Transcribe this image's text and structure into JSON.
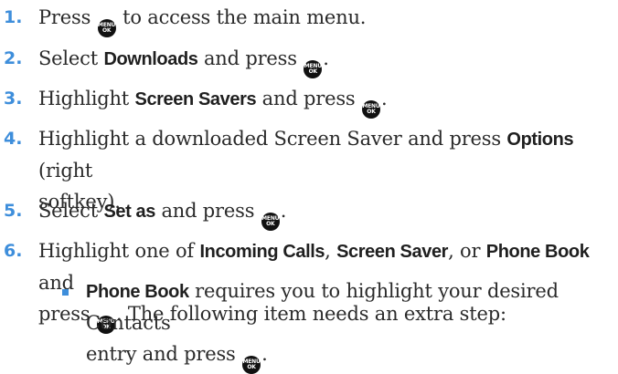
{
  "menu_key": {
    "line1": "MENU",
    "line2": "OK"
  },
  "steps": [
    {
      "number": "1.",
      "t1": "Press ",
      "t2": " to access the main menu."
    },
    {
      "number": "2.",
      "t1": "Select ",
      "kw1": "Downloads",
      "t2": " and press ",
      "t3": "."
    },
    {
      "number": "3.",
      "t1": "Highlight ",
      "kw1": "Screen Savers",
      "t2": " and press ",
      "t3": "."
    },
    {
      "number": "4.",
      "t1": "Highlight a downloaded Screen Saver and press ",
      "kw1": "Options",
      "t2": " (right",
      "t3": "softkey)."
    },
    {
      "number": "5.",
      "t1": "Select ",
      "kw1": "Set as",
      "t2": " and press ",
      "t3": "."
    },
    {
      "number": "6.",
      "t1": "Highlight one of ",
      "kw1": "Incoming Calls",
      "t2": ", ",
      "kw2": "Screen Saver",
      "t3": ", or ",
      "kw3": "Phone Book",
      "t4": " and",
      "t5": "press ",
      "t6": ". The following item needs an extra step:"
    }
  ],
  "bullet": {
    "kw1": "Phone Book",
    "t1": " requires you to highlight your desired Contacts",
    "t2": "entry and press ",
    "t3": "."
  },
  "colors": {
    "accent": "#3e8edb",
    "text": "#2a2a2a",
    "key": "#111111"
  }
}
